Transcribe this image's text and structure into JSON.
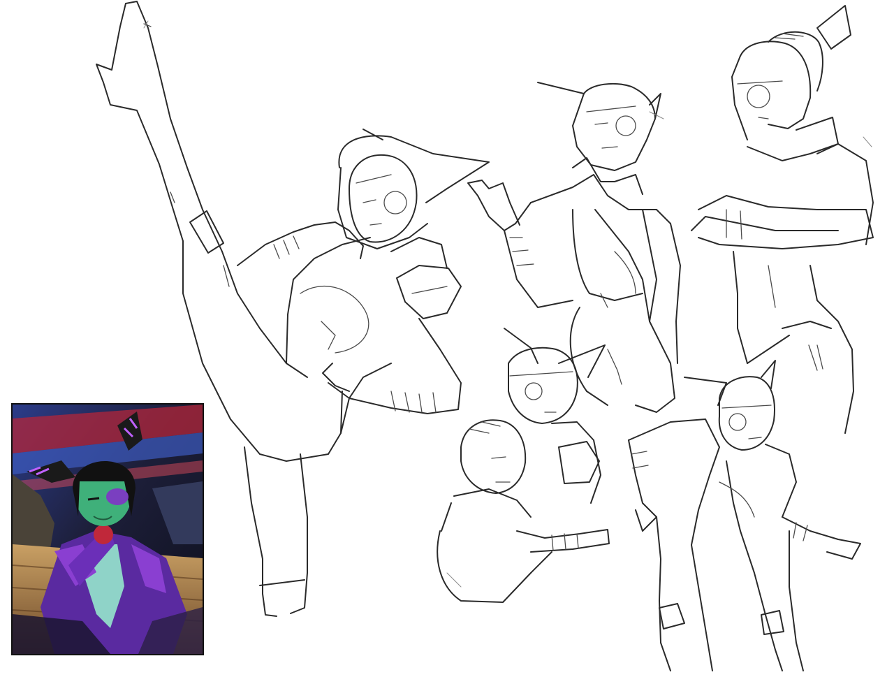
{
  "canvas": {
    "background": "#ffffff",
    "content": "sketch-sheet"
  },
  "colors": {
    "line": "#2a2a2a",
    "thumbnail_purple": "#8a3fd1",
    "thumbnail_skin": "#3fb07a",
    "thumbnail_red": "#c0283a",
    "thumbnail_blue": "#2b4fa8"
  }
}
